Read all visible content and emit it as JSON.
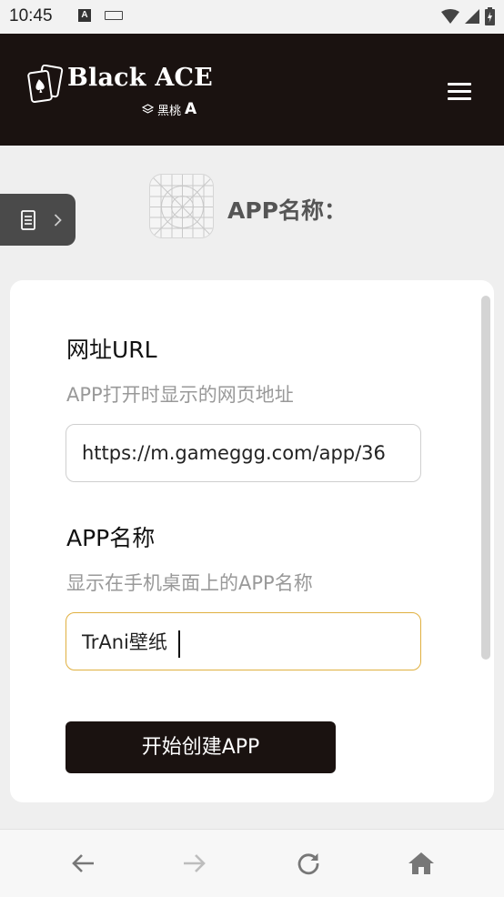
{
  "status_bar": {
    "time": "10:45",
    "notification_icon_letter": "A",
    "icons": [
      "wifi-icon",
      "signal-icon",
      "battery-charging-icon"
    ]
  },
  "header": {
    "brand_title": "Black ACE",
    "brand_subtitle_cn": "黑桃",
    "brand_subtitle_letter": "A",
    "menu_icon": "hamburger-menu-icon",
    "background_color": "#1a1210"
  },
  "side_tab": {
    "icons": [
      "document-icon",
      "chevron-right-icon"
    ]
  },
  "app_header": {
    "icon": "app-placeholder-icon",
    "title": "APP名称："
  },
  "form": {
    "url_label": "网址URL",
    "url_hint": "APP打开时显示的网页地址",
    "url_value": "https://m.gameggg.com/app/36",
    "name_label": "APP名称",
    "name_hint": "显示在手机桌面上的APP名称",
    "name_value": "TrAni壁纸",
    "submit_label": "开始创建APP",
    "focus_color": "#e0b040"
  },
  "bottom_nav": {
    "items": [
      "back-arrow-icon",
      "forward-arrow-icon",
      "refresh-icon",
      "home-icon"
    ]
  }
}
